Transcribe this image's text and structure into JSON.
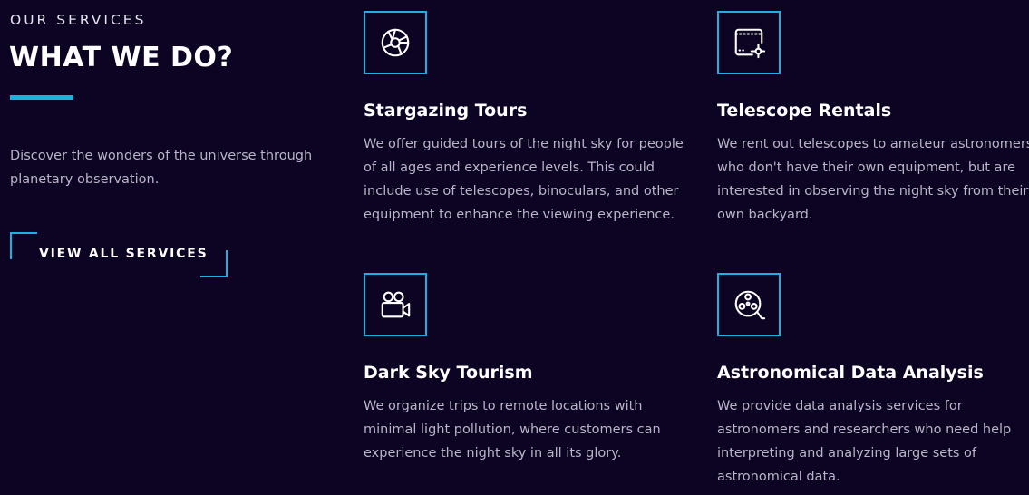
{
  "section": {
    "eyebrow": "OUR SERVICES",
    "title": "WHAT WE DO?",
    "intro": "Discover the wonders of the universe through planetary observation.",
    "cta_label": "VIEW ALL SERVICES"
  },
  "services": [
    {
      "title": "Stargazing Tours",
      "text": "We offer guided tours of the night sky for people of all ages and experience levels. This could include use of telescopes, binoculars, and other equipment to enhance the viewing experience.",
      "icon": "camera-aperture-icon"
    },
    {
      "title": "Telescope Rentals",
      "text": "We rent out telescopes to amateur astronomers who don't have their own equipment, but are interested in observing the night sky from their own backyard.",
      "icon": "film-edit-icon"
    },
    {
      "title": "Dark Sky Tourism",
      "text": "We organize trips to remote locations with minimal light pollution, where customers can experience the night sky in all its glory.",
      "icon": "video-camera-icon"
    },
    {
      "title": "Astronomical Data Analysis",
      "text": "We provide data analysis services for astronomers and researchers who need help interpreting and analyzing large sets of astronomical data.",
      "icon": "film-reel-icon"
    }
  ],
  "colors": {
    "background": "#0c0422",
    "accent": "#1bb2e3",
    "body_text": "#b9b5c8",
    "heading": "#ffffff"
  }
}
